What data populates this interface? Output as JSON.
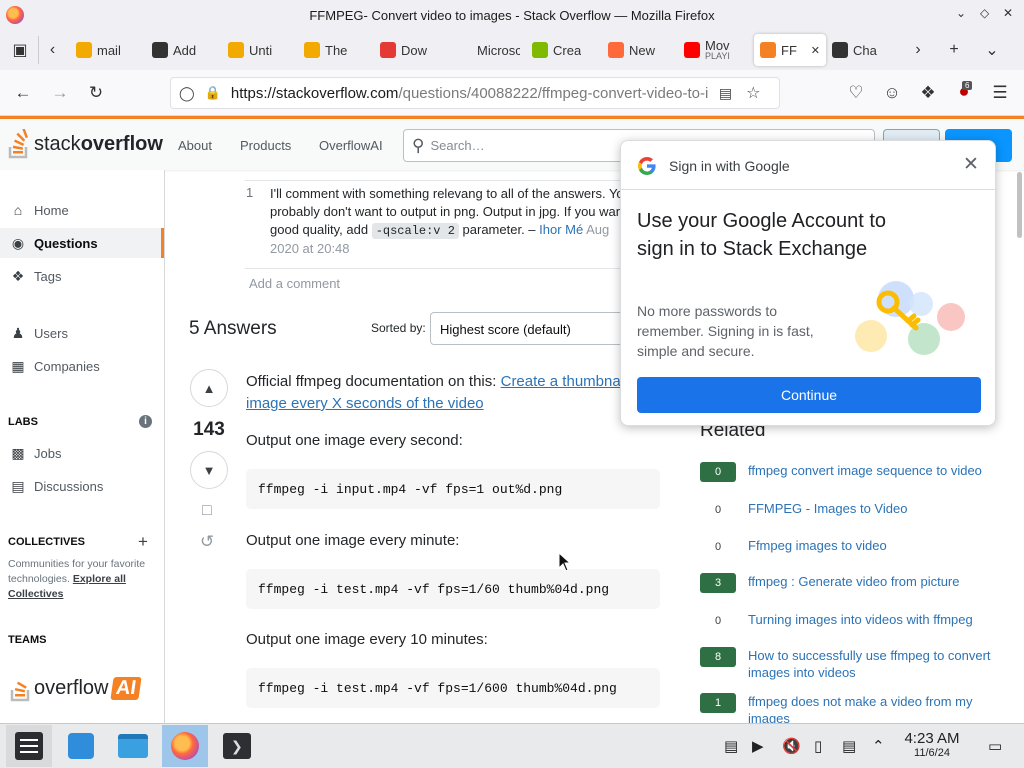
{
  "window": {
    "title": "FFMPEG- Convert video to images - Stack Overflow — Mozilla Firefox"
  },
  "tabs": [
    {
      "label": "mail",
      "icon": "mail-icon",
      "color": "#f2a900"
    },
    {
      "label": "Add",
      "icon": "puzzle-icon",
      "color": "#333333"
    },
    {
      "label": "Unti",
      "icon": "untitled-icon",
      "color": "#f2a900"
    },
    {
      "label": "The",
      "icon": "the-icon",
      "color": "#f2a900"
    },
    {
      "label": "Dow",
      "icon": "download-x-icon",
      "color": "#e53935"
    },
    {
      "label": "Microsc",
      "icon": "blank-icon",
      "color": "#f0f0f4"
    },
    {
      "label": "Crea",
      "icon": "microsoft-icon",
      "color": "#7fba00"
    },
    {
      "label": "New",
      "icon": "firefox-icon",
      "color": "#ff6a3d"
    },
    {
      "label": "Mov",
      "sublabel": "PLAYI",
      "icon": "youtube-icon",
      "color": "#ff0000"
    },
    {
      "label": "FF",
      "icon": "stackoverflow-icon",
      "color": "#f48225",
      "active": true
    },
    {
      "label": "Cha",
      "icon": "chatgpt-icon",
      "color": "#333333"
    }
  ],
  "navbar": {
    "url_host": "https://stackoverflow.com",
    "url_path": "/questions/40088222/ffmpeg-convert-video-to-i",
    "extension_badge": "6"
  },
  "so_header": {
    "logo_light": "stack",
    "logo_bold": "overflow",
    "nav": [
      "About",
      "Products",
      "OverflowAI"
    ],
    "search_placeholder": "Search…"
  },
  "sidebar": {
    "home": "Home",
    "questions": "Questions",
    "tags": "Tags",
    "users": "Users",
    "companies": "Companies",
    "labs_heading": "LABS",
    "jobs": "Jobs",
    "discussions": "Discussions",
    "collectives_heading": "COLLECTIVES",
    "collectives_text": "Communities for your favorite technologies.",
    "explore_collectives": "Explore all Collectives",
    "teams_heading": "TEAMS",
    "overflow_ai_light": "overflow",
    "overflow_ai_bold": "AI"
  },
  "comment": {
    "score": "1",
    "line1": "I'll comment with something relevang to all of the answers. Yo",
    "line2": "probably don't want to output in png. Output in jpg. If you war",
    "line3_pre": "good quality, add",
    "line3_code": "-qscale:v 2",
    "line3_post": "parameter. –",
    "author": "Ihor Mé",
    "date_part1": "Aug",
    "date_part2": "2020 at 20:48",
    "add_comment": "Add a comment"
  },
  "answers": {
    "heading": "5 Answers",
    "sorted_by": "Sorted by:",
    "sort_value": "Highest score (default)",
    "score": "143",
    "intro": "Official ffmpeg documentation on this:",
    "link_part1": "Create a thumbna",
    "link_part2": "image every X seconds of the video",
    "p1": "Output one image every second:",
    "code1": "ffmpeg -i input.mp4 -vf fps=1 out%d.png",
    "p2": "Output one image every minute:",
    "code2": "ffmpeg -i test.mp4 -vf fps=1/60 thumb%04d.png",
    "p3": "Output one image every 10 minutes:",
    "code3": "ffmpeg -i test.mp4 -vf fps=1/600 thumb%04d.png"
  },
  "related": {
    "heading": "Related",
    "items": [
      {
        "score": "0",
        "title": "ffmpeg convert image sequence to video",
        "answered": true
      },
      {
        "score": "0",
        "title": "FFMPEG - Images to Video",
        "answered": false
      },
      {
        "score": "0",
        "title": "Ffmpeg images to video",
        "answered": false
      },
      {
        "score": "3",
        "title": "ffmpeg : Generate video from picture",
        "answered": true
      },
      {
        "score": "0",
        "title": "Turning images into videos with ffmpeg",
        "answered": false
      },
      {
        "score": "8",
        "title": "How to successfully use ffmpeg to convert images into videos",
        "answered": true
      },
      {
        "score": "1",
        "title": "ffmpeg does not make a video from my images",
        "answered": true
      }
    ]
  },
  "google_popup": {
    "title": "Sign in with Google",
    "heading": "Use your Google Account to sign in to Stack Exchange",
    "body": "No more passwords to remember. Signing in is fast, simple and secure.",
    "continue": "Continue"
  },
  "taskbar": {
    "time": "4:23 AM",
    "date": "11/6/24"
  },
  "colors": {
    "so_orange": "#f48225",
    "so_blue": "#0a95ff",
    "link": "#2b73b6",
    "google_blue": "#1a73e8",
    "answered_green": "#2f6f44"
  }
}
